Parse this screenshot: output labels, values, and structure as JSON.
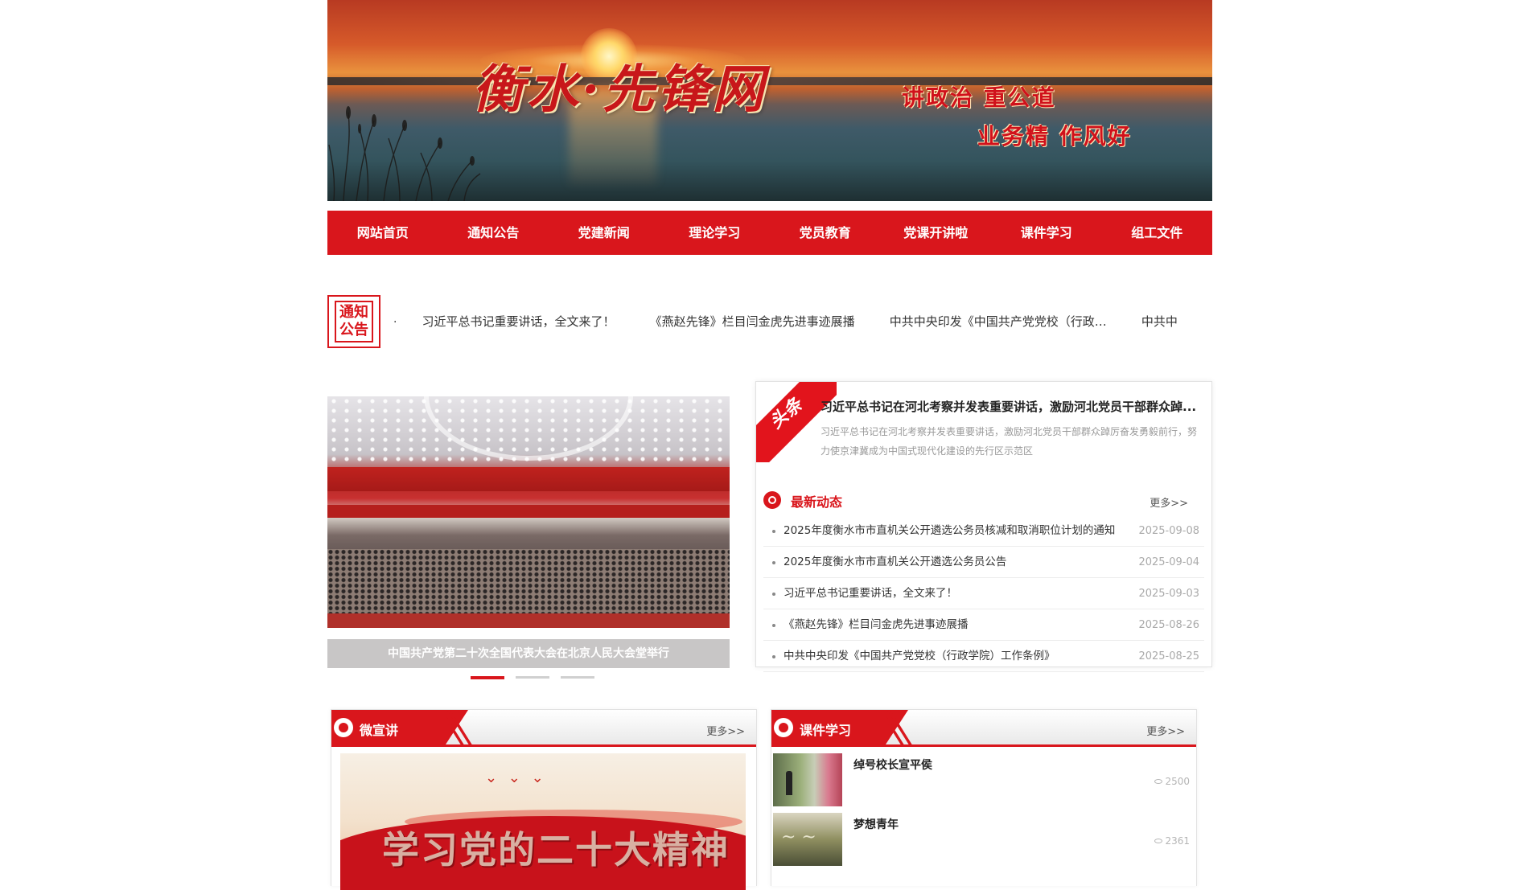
{
  "banner": {
    "title": "衡水·先锋网",
    "slogan_line1": "讲政治 重公道",
    "slogan_line2": "业务精 作风好"
  },
  "nav": [
    "网站首页",
    "通知公告",
    "党建新闻",
    "理论学习",
    "党员教育",
    "党课开讲啦",
    "课件学习",
    "组工文件"
  ],
  "notice": {
    "icon_text": "通知公告",
    "items": [
      "习近平总书记重要讲话，全文来了！",
      "《燕赵先锋》栏目闫金虎先进事迹展播",
      "中共中央印发《中国共产党党校（行政…",
      "中共中"
    ]
  },
  "slider": {
    "caption": "中国共产党第二十次全国代表大会在北京人民大会堂举行",
    "dot_count": 3,
    "active_index": 0
  },
  "headline": {
    "tag": "头条",
    "title": "习近平总书记在河北考察并发表重要讲话，激励河北党员干部群众踔...",
    "desc": "习近平总书记在河北考察并发表重要讲话，激励河北党员干部群众踔厉奋发勇毅前行，努力使京津冀成为中国式现代化建设的先行区示范区"
  },
  "latest": {
    "title": "最新动态",
    "more": "更多>>",
    "items": [
      {
        "title": "2025年度衡水市市直机关公开遴选公务员核减和取消职位计划的通知",
        "date": "2025-09-08"
      },
      {
        "title": "2025年度衡水市市直机关公开遴选公务员公告",
        "date": "2025-09-04"
      },
      {
        "title": "习近平总书记重要讲话，全文来了！",
        "date": "2025-09-03"
      },
      {
        "title": "《燕赵先锋》栏目闫金虎先进事迹展播",
        "date": "2025-08-26"
      },
      {
        "title": "中共中央印发《中国共产党党校（行政学院）工作条例》",
        "date": "2025-08-25"
      }
    ]
  },
  "panels": {
    "wxj": {
      "title": "微宣讲",
      "more": "更多>>",
      "image_text": "学习党的二十大精神"
    },
    "kjxx": {
      "title": "课件学习",
      "more": "更多>>",
      "items": [
        {
          "title": "绰号校长宣平侯",
          "views": "2500"
        },
        {
          "title": "梦想青年",
          "views": "2361"
        }
      ]
    }
  },
  "colors": {
    "brand_red": "#d9161c",
    "nav_text": "#ffffff",
    "date_gray": "#aaaaaa"
  }
}
